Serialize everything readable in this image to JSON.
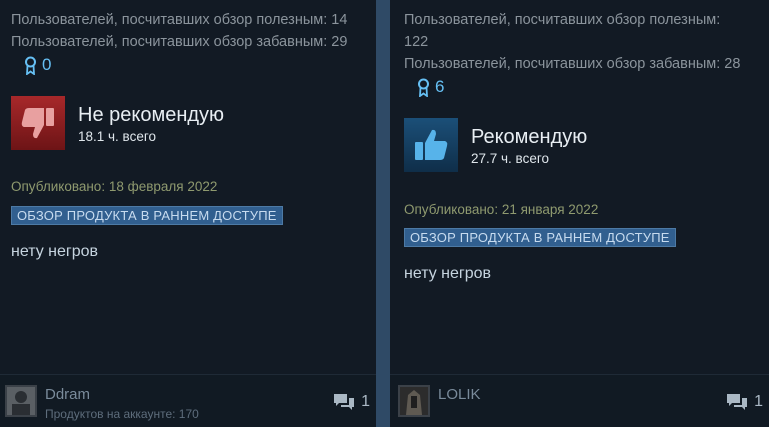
{
  "reviews": [
    {
      "helpful_text": "Пользователей, посчитавших обзор полезным: 14",
      "funny_text": "Пользователей, посчитавших обзор забавным: 29",
      "awards_count": "0",
      "verdict": "Не рекомендую",
      "verdict_type": "thumbs-down",
      "hours": "18.1 ч. всего",
      "posted": "Опубликовано: 18 февраля 2022",
      "badge": "ОБЗОР ПРОДУКТА В РАННЕМ ДОСТУПЕ",
      "body": "нету негров",
      "author": "Ddram",
      "author_products": "Продуктов на аккаунте: 170",
      "comments_count": "1"
    },
    {
      "helpful_text_line1": "Пользователей, посчитавших обзор полезным:",
      "helpful_text_line2": "122",
      "funny_text": "Пользователей, посчитавших обзор забавным: 28",
      "awards_count": "6",
      "verdict": "Рекомендую",
      "verdict_type": "thumbs-up",
      "hours": "27.7 ч. всего",
      "posted": "Опубликовано: 21 января 2022",
      "badge": "ОБЗОР ПРОДУКТА В РАННЕМ ДОСТУПЕ",
      "body": "нету негров",
      "author": "LOLIK",
      "comments_count": "1"
    }
  ],
  "colors": {
    "background": "#1b2838",
    "card": "#121a24",
    "accent_blue": "#66c0f4",
    "badge_bg": "#315f8f",
    "thumb_down": "#a7282a",
    "thumb_up": "#1b4f78"
  }
}
